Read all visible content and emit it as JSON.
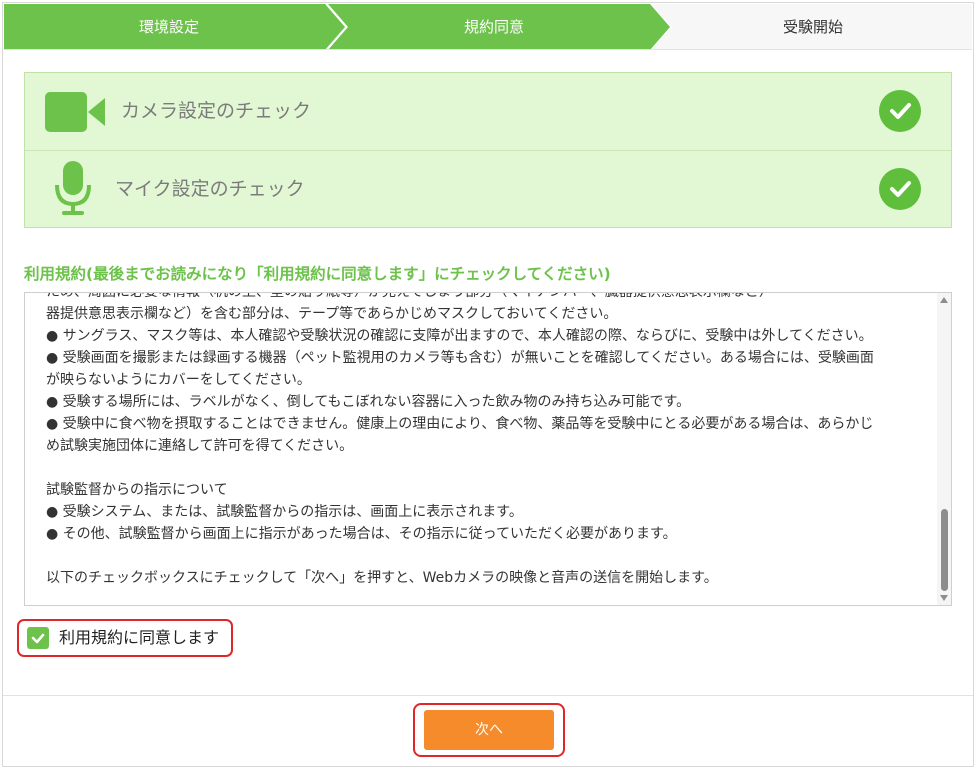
{
  "stepper": {
    "steps": [
      {
        "label": "環境設定",
        "state": "done"
      },
      {
        "label": "規約同意",
        "state": "current"
      },
      {
        "label": "受験開始",
        "state": "pending"
      }
    ],
    "done_color": "#6cc24a"
  },
  "checks": {
    "items": [
      {
        "label": "カメラ設定のチェック",
        "icon": "camera-icon",
        "status": "ok"
      },
      {
        "label": "マイク設定のチェック",
        "icon": "microphone-icon",
        "status": "ok"
      }
    ]
  },
  "terms": {
    "heading": "利用規約(最後までお読みになり「利用規約に同意します」にチェックしてください)",
    "lines": [
      "ため、周囲に必要な情報（机の上、壁の貼り紙等）が見えてしまう部分（マイナンバー、臓器提供意思表示欄など）",
      "器提供意思表示欄など）を含む部分は、テープ等であらかじめマスクしておいてください。",
      "● サングラス、マスク等は、本人確認や受験状況の確認に支障が出ますので、本人確認の際、ならびに、受験中は外してください。",
      "● 受験画面を撮影または録画する機器（ペット監視用のカメラ等も含む）が無いことを確認してください。ある場合には、受験画面",
      "が映らないようにカバーをしてください。",
      "● 受験する場所には、ラベルがなく、倒してもこぼれない容器に入った飲み物のみ持ち込み可能です。",
      "● 受験中に食べ物を摂取することはできません。健康上の理由により、食べ物、薬品等を受験中にとる必要がある場合は、あらかじ",
      "め試験実施団体に連絡して許可を得てください。",
      "",
      "試験監督からの指示について",
      "● 受験システム、または、試験監督からの指示は、画面上に表示されます。",
      "● その他、試験監督から画面上に指示があった場合は、その指示に従っていただく必要があります。",
      "",
      "以下のチェックボックスにチェックして「次へ」を押すと、Webカメラの映像と音声の送信を開始します。"
    ]
  },
  "agree": {
    "label": "利用規約に同意します",
    "checked": true
  },
  "next_button": {
    "label": "次へ"
  },
  "colors": {
    "green": "#6cc24a",
    "orange": "#f58b2a",
    "highlight": "#e0262b"
  }
}
